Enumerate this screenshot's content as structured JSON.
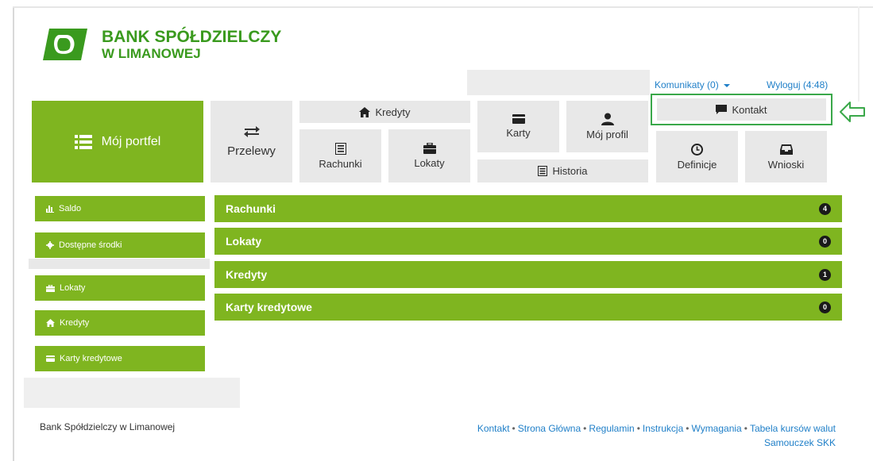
{
  "brand": {
    "line1": "BANK SPÓŁDZIELCZY",
    "line2": "W LIMANOWEJ",
    "color": "#3a9a1e"
  },
  "topbar": {
    "messages": "Komunikaty (0)",
    "logout": "Wyloguj (4:48)"
  },
  "nav": {
    "portfel": "Mój portfel",
    "przelewy": "Przelewy",
    "kredyty": "Kredyty",
    "rachunki": "Rachunki",
    "lokaty": "Lokaty",
    "karty": "Karty",
    "profil": "Mój profil",
    "historia": "Historia",
    "kontakt": "Kontakt",
    "definicje": "Definicje",
    "wnioski": "Wnioski"
  },
  "sidebar": {
    "items": [
      {
        "label": "Saldo",
        "icon": "bar-chart-icon"
      },
      {
        "label": "Dostępne środki",
        "icon": "gear-icon"
      },
      {
        "label": "Lokaty",
        "icon": "briefcase-icon"
      },
      {
        "label": "Kredyty",
        "icon": "home-icon"
      },
      {
        "label": "Karty kredytowe",
        "icon": "card-icon"
      }
    ]
  },
  "summary": {
    "rows": [
      {
        "label": "Rachunki",
        "count": "4"
      },
      {
        "label": "Lokaty",
        "count": "0"
      },
      {
        "label": "Kredyty",
        "count": "1"
      },
      {
        "label": "Karty kredytowe",
        "count": "0"
      }
    ]
  },
  "footer": {
    "bank": "Bank Spółdzielczy w Limanowej",
    "links": [
      "Kontakt",
      "Strona Główna",
      "Regulamin",
      "Instrukcja",
      "Wymagania",
      "Tabela kursów walut",
      "Samouczek SKK"
    ],
    "separator": "•"
  },
  "colors": {
    "accent": "#7fb520",
    "tile": "#e8e8e8",
    "link": "#1f7fc8",
    "annotation": "#3aa84a"
  }
}
